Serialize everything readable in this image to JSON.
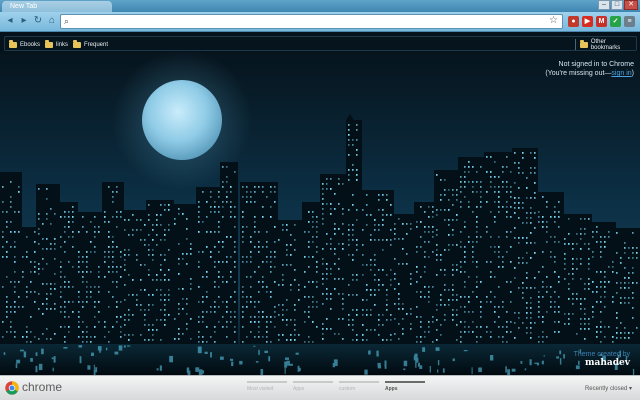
{
  "tab": {
    "title": "New Tab"
  },
  "window_controls": [
    "minimize-button",
    "maximize-button",
    "close-button"
  ],
  "toolbar": {
    "nav_icons": [
      "back-arrow-icon",
      "forward-arrow-icon",
      "reload-icon",
      "home-icon"
    ],
    "omnibox_value": "",
    "omnibox_placeholder": "",
    "extensions": [
      {
        "name": "extension-red-icon",
        "color": "#c0392b",
        "glyph": "●"
      },
      {
        "name": "extension-youtube-icon",
        "color": "#d62d20",
        "glyph": "▶"
      },
      {
        "name": "extension-gmail-icon",
        "color": "#c8312a",
        "glyph": "M"
      },
      {
        "name": "extension-green-icon",
        "color": "#27a347",
        "glyph": "✓"
      },
      {
        "name": "chrome-menu-icon",
        "color": "#6b7f8c",
        "glyph": "≡"
      }
    ]
  },
  "bookmarks": {
    "items": [
      {
        "label": "Ebooks"
      },
      {
        "label": "links"
      },
      {
        "label": "Frequent"
      }
    ],
    "other": "Other bookmarks"
  },
  "signin": {
    "line1": "Not signed in to Chrome",
    "line2_prefix": "(You're missing out—",
    "line2_link": "sign in",
    "line2_suffix": ")"
  },
  "credit": {
    "label": "Theme created by",
    "name": "mahadev"
  },
  "bottom_bar": {
    "brand": "chrome",
    "tabs": [
      {
        "label": "Most visited",
        "active": false
      },
      {
        "label": "Apps",
        "active": false
      },
      {
        "label": "custom",
        "active": false
      },
      {
        "label": "Apps",
        "active": true
      }
    ],
    "recently_closed": "Recently closed ▾"
  },
  "colors": {
    "sky": "#0a2a3c",
    "moon": "#9fd3ee",
    "city": "#041018",
    "window_glow": "#7fe3ff",
    "water": "#031018"
  }
}
